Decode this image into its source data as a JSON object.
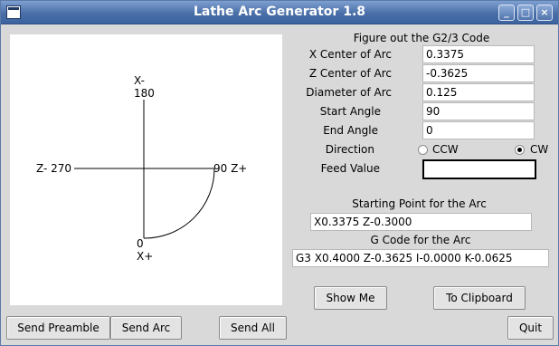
{
  "window": {
    "title": "Lathe Arc Generator 1.8"
  },
  "canvas": {
    "x_top_line1": "X-",
    "x_top_line2": "180",
    "z_left": "Z- 270",
    "z_right": "90 Z+",
    "x_bottom_line1": "0",
    "x_bottom_line2": "X+"
  },
  "form": {
    "heading": "Figure out the G2/3 Code",
    "fields": [
      {
        "label": "X Center of Arc",
        "value": "0.3375"
      },
      {
        "label": "Z Center of Arc",
        "value": "-0.3625"
      },
      {
        "label": "Diameter of Arc",
        "value": "0.125"
      },
      {
        "label": "Start Angle",
        "value": "90"
      },
      {
        "label": "End Angle",
        "value": "0"
      }
    ],
    "direction_label": "Direction",
    "direction_options": [
      "CCW",
      "CW"
    ],
    "direction_selected": "CW",
    "feed_label": "Feed Value",
    "feed_value": ""
  },
  "output": {
    "start_heading": "Starting Point for the Arc",
    "start_value": "X0.3375 Z-0.3000",
    "gcode_heading": "G Code for the Arc",
    "gcode_value": "G3 X0.4000 Z-0.3625 I-0.0000 K-0.0625"
  },
  "buttons": {
    "show_me": "Show Me",
    "to_clipboard": "To Clipboard",
    "send_preamble": "Send Preamble",
    "send_arc": "Send Arc",
    "send_all": "Send All",
    "quit": "Quit"
  }
}
